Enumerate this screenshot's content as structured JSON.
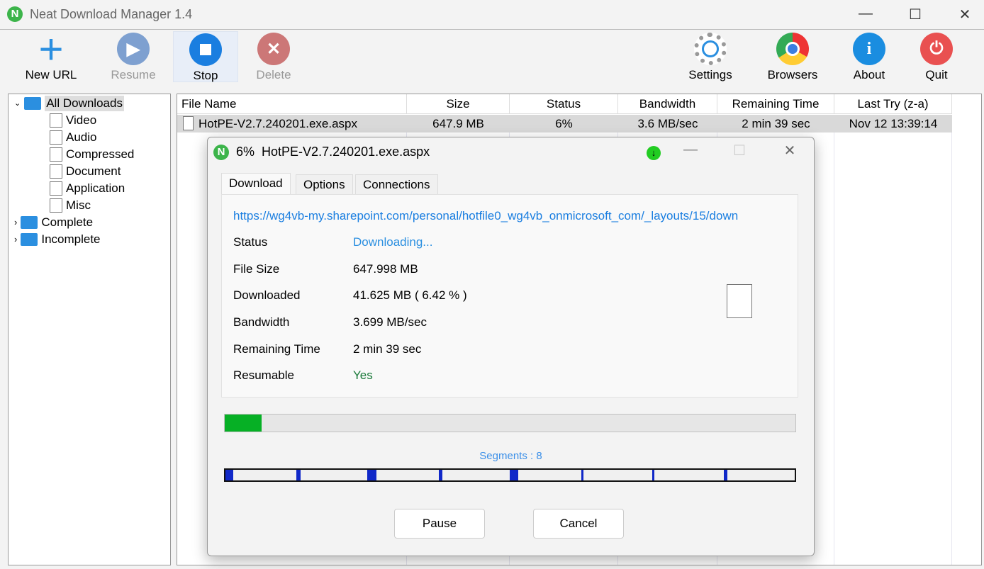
{
  "window": {
    "title": "Neat Download Manager 1.4"
  },
  "toolbar": {
    "new_url": "New URL",
    "resume": "Resume",
    "stop": "Stop",
    "delete": "Delete",
    "settings": "Settings",
    "browsers": "Browsers",
    "about": "About",
    "quit": "Quit"
  },
  "tree": {
    "all": "All Downloads",
    "children": [
      "Video",
      "Audio",
      "Compressed",
      "Document",
      "Application",
      "Misc"
    ],
    "complete": "Complete",
    "incomplete": "Incomplete"
  },
  "list": {
    "columns": [
      "File Name",
      "Size",
      "Status",
      "Bandwidth",
      "Remaining Time",
      "Last Try (z-a)"
    ],
    "rows": [
      {
        "name": "HotPE-V2.7.240201.exe.aspx",
        "size": "647.9 MB",
        "status": "6%",
        "bandwidth": "3.6 MB/sec",
        "remaining": "2 min  39 sec",
        "last_try": "Nov 12 13:39:14"
      }
    ]
  },
  "dialog": {
    "percent": "6%",
    "title": "HotPE-V2.7.240201.exe.aspx",
    "tabs": [
      "Download",
      "Options",
      "Connections"
    ],
    "url": "https://wg4vb-my.sharepoint.com/personal/hotfile0_wg4vb_onmicrosoft_com/_layouts/15/down",
    "labels": [
      "Status",
      "File Size",
      "Downloaded",
      "Bandwidth",
      "Remaining Time",
      "Resumable"
    ],
    "values": [
      "Downloading...",
      "647.998 MB",
      "41.625 MB ( 6.42 % )",
      "3.699 MB/sec",
      "2 min  39 sec",
      "Yes"
    ],
    "progress_percent": 6.42,
    "segments_label": "Segments : 8",
    "segment_progress": [
      0.11,
      0.06,
      0.12,
      0.05,
      0.11,
      0.03,
      0.02,
      0.05
    ],
    "pause": "Pause",
    "cancel": "Cancel"
  }
}
